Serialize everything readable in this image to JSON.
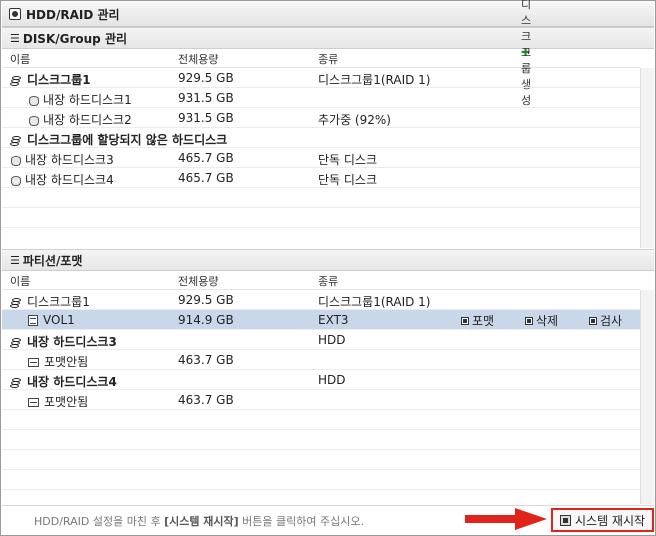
{
  "window": {
    "title": "HDD/RAID 관리"
  },
  "disk_group_section": {
    "title": "DISK/Group 관리",
    "create_button": "디스크그룹 생성",
    "columns": {
      "name": "이름",
      "capacity": "전체용량",
      "type": "종류"
    },
    "rows": [
      {
        "name": "디스크그룹1",
        "capacity": "929.5 GB",
        "type": "디스크그룹1(RAID 1)"
      },
      {
        "name": "내장 하드디스크1",
        "capacity": "931.5 GB",
        "type": ""
      },
      {
        "name": "내장 하드디스크2",
        "capacity": "931.5 GB",
        "type": "추가중 (92%)"
      },
      {
        "name": "디스크그룹에 할당되지 않은 하드디스크",
        "capacity": "",
        "type": ""
      },
      {
        "name": "내장 하드디스크3",
        "capacity": "465.7 GB",
        "type": "단독 디스크"
      },
      {
        "name": "내장 하드디스크4",
        "capacity": "465.7 GB",
        "type": "단독 디스크"
      }
    ]
  },
  "partition_section": {
    "title": "파티션/포맷",
    "columns": {
      "name": "이름",
      "capacity": "전체용량",
      "type": "종류"
    },
    "rows": [
      {
        "name": "디스크그룹1",
        "capacity": "929.5 GB",
        "type": "디스크그룹1(RAID 1)"
      },
      {
        "name": "VOL1",
        "capacity": "914.9 GB",
        "type": "EXT3"
      },
      {
        "name": "내장 하드디스크3",
        "capacity": "",
        "type": "HDD"
      },
      {
        "name": "포맷안됨",
        "capacity": "463.7 GB",
        "type": ""
      },
      {
        "name": "내장 하드디스크4",
        "capacity": "",
        "type": "HDD"
      },
      {
        "name": "포맷안됨",
        "capacity": "463.7 GB",
        "type": ""
      }
    ],
    "actions": {
      "format": "포맷",
      "delete": "삭제",
      "check": "검사"
    }
  },
  "footer": {
    "message_pre": "HDD/RAID 설정을 마친 후 ",
    "message_bold": "[시스템 재시작]",
    "message_post": " 버튼을 클릭하여 주십시오.",
    "restart_button": "시스템 재시작",
    "arrow_color": "#e0231b"
  }
}
